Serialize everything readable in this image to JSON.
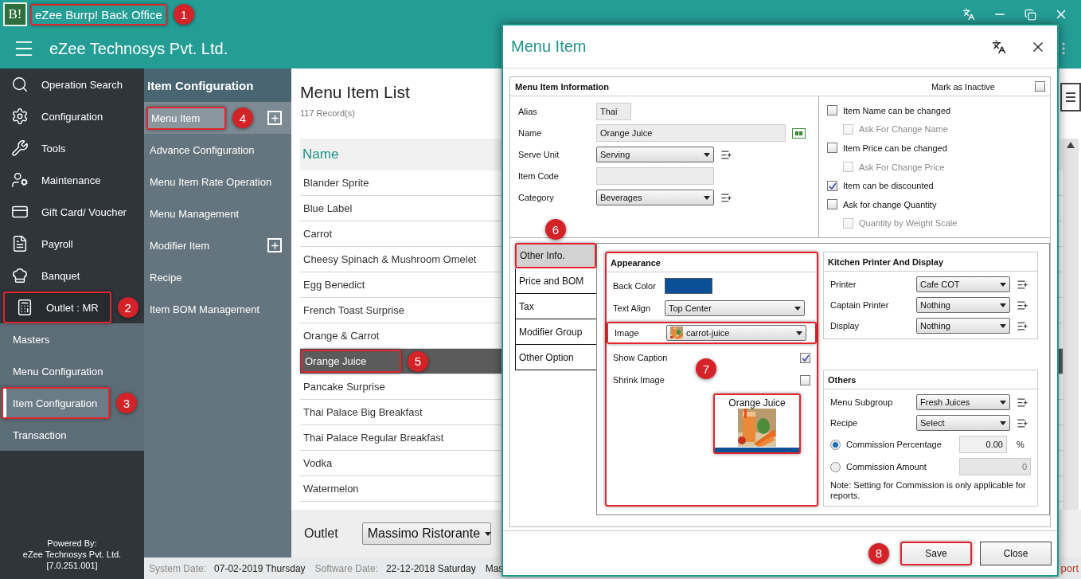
{
  "app": {
    "logo": "B!",
    "title": "eZee Burrp! Back Office",
    "title_highlighted": true,
    "title_callout": "1",
    "company": "eZee Technosys Pvt. Ltd."
  },
  "sidebar": {
    "items": [
      {
        "label": "Operation Search",
        "highlighted": false
      },
      {
        "label": "Configuration",
        "highlighted": false
      },
      {
        "label": "Tools",
        "highlighted": false
      },
      {
        "label": "Maintenance",
        "highlighted": false
      },
      {
        "label": "Gift Card/ Voucher",
        "highlighted": false
      },
      {
        "label": "Payroll",
        "highlighted": false
      },
      {
        "label": "Banquet",
        "highlighted": false
      },
      {
        "label": "Outlet : MR",
        "highlighted": true,
        "callout": "2"
      }
    ],
    "sections": [
      {
        "label": "Masters",
        "selected": false,
        "highlighted": false
      },
      {
        "label": "Menu Configuration",
        "selected": false,
        "highlighted": false
      },
      {
        "label": "Item Configuration",
        "selected": true,
        "highlighted": true,
        "callout": "3"
      },
      {
        "label": "Transaction",
        "selected": false,
        "highlighted": false
      }
    ],
    "footer": [
      "Powered By:",
      "eZee Technosys Pvt. Ltd.",
      "[7.0.251.001]"
    ]
  },
  "submenu": {
    "title": "Item Configuration",
    "items": [
      {
        "label": "Menu Item",
        "selected": true,
        "highlighted": true,
        "addable": true,
        "callout": "4"
      },
      {
        "label": "Advance Configuration",
        "selected": false,
        "highlighted": false,
        "addable": false
      },
      {
        "label": "Menu Item Rate Operation",
        "selected": false,
        "highlighted": false,
        "addable": false
      },
      {
        "label": "Menu Management",
        "selected": false,
        "highlighted": false,
        "addable": false
      },
      {
        "label": "Modifier Item",
        "selected": false,
        "highlighted": false,
        "addable": true
      },
      {
        "label": "Recipe",
        "selected": false,
        "highlighted": false,
        "addable": false
      },
      {
        "label": "Item BOM Management",
        "selected": false,
        "highlighted": false,
        "addable": false
      }
    ]
  },
  "list": {
    "title": "Menu Item List",
    "count": "117 Record(s)",
    "column": "Name",
    "rows": [
      {
        "name": "Blander Sprite",
        "selected": false,
        "highlighted": false
      },
      {
        "name": "Blue Label",
        "selected": false,
        "highlighted": false
      },
      {
        "name": "Carrot",
        "selected": false,
        "highlighted": false
      },
      {
        "name": "Cheesy Spinach & Mushroom Omelet",
        "selected": false,
        "highlighted": false
      },
      {
        "name": "Egg Benedict",
        "selected": false,
        "highlighted": false
      },
      {
        "name": "French Toast Surprise",
        "selected": false,
        "highlighted": false
      },
      {
        "name": "Orange & Carrot",
        "selected": false,
        "highlighted": false
      },
      {
        "name": "Orange Juice",
        "selected": true,
        "highlighted": true,
        "callout": "5"
      },
      {
        "name": "Pancake Surprise",
        "selected": false,
        "highlighted": false
      },
      {
        "name": "Thai Palace Big Breakfast",
        "selected": false,
        "highlighted": false
      },
      {
        "name": "Thai Palace Regular Breakfast",
        "selected": false,
        "highlighted": false
      },
      {
        "name": "Vodka",
        "selected": false,
        "highlighted": false
      },
      {
        "name": "Watermelon",
        "selected": false,
        "highlighted": false
      }
    ]
  },
  "outlet": {
    "label": "Outlet",
    "value": "Massimo Ristorante"
  },
  "status": {
    "fields": [
      {
        "label": "System Date:",
        "value": "07-02-2019 Thursday"
      },
      {
        "label": "Software Date:",
        "value": "22-12-2018 Saturday"
      }
    ],
    "trailing": "Mas",
    "edge": "port"
  },
  "dialog": {
    "title": "Menu Item",
    "info": {
      "title": "Menu Item Information",
      "inactive_label": "Mark as Inactive",
      "inactive": false,
      "fields": [
        {
          "label": "Alias",
          "value": "Thai",
          "kind": "short"
        },
        {
          "label": "Name",
          "value": "Orange Juice",
          "kind": "wide"
        },
        {
          "label": "Serve Unit",
          "value": "Serving",
          "kind": "select"
        },
        {
          "label": "Item Code",
          "kind": "text"
        },
        {
          "label": "Category",
          "value": "Beverages",
          "kind": "select"
        }
      ],
      "options": [
        {
          "label": "Item Name can be changed",
          "checked": false,
          "disabled": false,
          "children": [
            {
              "label": "Ask For Change Name",
              "checked": false,
              "disabled": true
            }
          ]
        },
        {
          "label": "Item Price can be changed",
          "checked": false,
          "disabled": false,
          "children": [
            {
              "label": "Ask For Change Price",
              "checked": false,
              "disabled": true
            }
          ]
        },
        {
          "label": "Item can be discounted",
          "checked": true,
          "disabled": false
        },
        {
          "label": "Ask for change Quantity",
          "checked": false,
          "disabled": false,
          "children": [
            {
              "label": "Quantity by Weight Scale",
              "checked": false,
              "disabled": true
            }
          ]
        }
      ]
    },
    "tabs": [
      {
        "label": "Other Info.",
        "selected": true,
        "highlighted": true,
        "callout": "6"
      },
      {
        "label": "Price and BOM",
        "selected": false,
        "highlighted": false
      },
      {
        "label": "Tax",
        "selected": false,
        "highlighted": false
      },
      {
        "label": "Modifier Group",
        "selected": false,
        "highlighted": false
      },
      {
        "label": "Other Option",
        "selected": false,
        "highlighted": false
      }
    ],
    "appearance": {
      "title": "Appearance",
      "highlighted": true,
      "callout": "7",
      "back_color_label": "Back Color",
      "back_color": {
        "color": "#0b4f96"
      },
      "text_align_label": "Text Align",
      "text_align": "Top Center",
      "image_label": "Image",
      "image": "carrot-juice",
      "image_highlighted": true,
      "show_caption_label": "Show Caption",
      "show_caption": true,
      "shrink_label": "Shrink Image",
      "shrink": false,
      "preview_caption": "Orange Juice",
      "preview_highlighted": true
    },
    "kitchen": {
      "title": "Kitchen Printer And Display",
      "rows": [
        {
          "label": "Printer",
          "value": "Cafe COT"
        },
        {
          "label": "Captain Printer",
          "value": "Nothing"
        },
        {
          "label": "Display",
          "value": "Nothing"
        }
      ]
    },
    "others": {
      "title": "Others",
      "rows": [
        {
          "label": "Menu Subgroup",
          "value": "Fresh Juices"
        },
        {
          "label": "Recipe",
          "value": "Select"
        }
      ],
      "commission": [
        {
          "label": "Commission Percentage",
          "selected": true,
          "value": "0.00",
          "unit": "%"
        },
        {
          "label": "Commission Amount",
          "selected": false,
          "value": "0"
        }
      ],
      "note": "Note: Setting for Commission is only applicable for reports."
    },
    "buttons": [
      {
        "label": "Save",
        "highlighted": true,
        "callout": "8"
      },
      {
        "label": "Close",
        "highlighted": false
      }
    ]
  }
}
